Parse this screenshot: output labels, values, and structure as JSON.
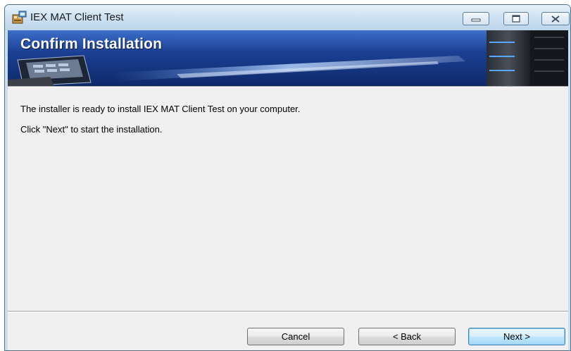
{
  "window": {
    "title": "IEX MAT Client Test",
    "icons": {
      "app": "installer-icon",
      "minimize": "minimize-icon",
      "maximize": "maximize-icon",
      "close": "close-icon"
    }
  },
  "banner": {
    "title": "Confirm Installation",
    "art": "laptop-and-server-graphic"
  },
  "content": {
    "line1": "The installer is ready to install IEX MAT Client Test on your computer.",
    "line2": "Click \"Next\" to start the installation."
  },
  "buttons": {
    "cancel": "Cancel",
    "back": "< Back",
    "next": "Next >"
  },
  "colors": {
    "banner": "#1b3f93",
    "client_bg": "#f0f0f0",
    "default_button": "#bee6fd"
  }
}
